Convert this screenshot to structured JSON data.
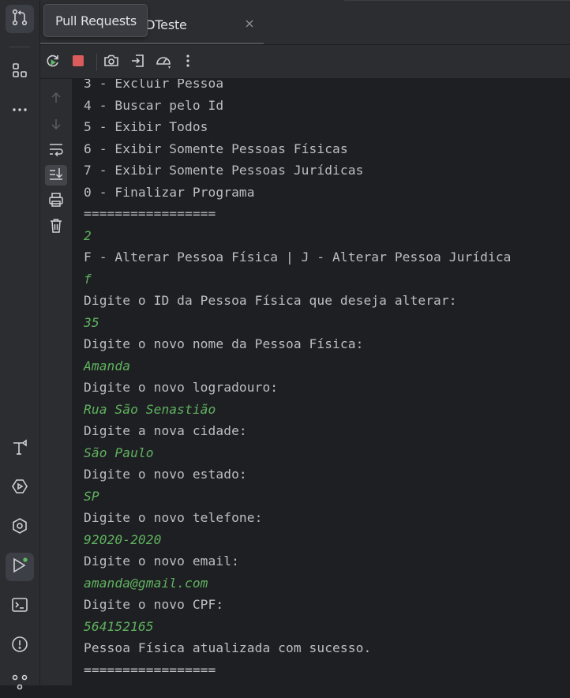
{
  "tooltip": {
    "text": "Pull Requests"
  },
  "tab": {
    "title": "astroBDTeste"
  },
  "console": {
    "lines": [
      {
        "text": "3 - Excluir Pessoa",
        "input": false
      },
      {
        "text": "4 - Buscar pelo Id",
        "input": false
      },
      {
        "text": "5 - Exibir Todos",
        "input": false
      },
      {
        "text": "6 - Exibir Somente Pessoas Físicas",
        "input": false
      },
      {
        "text": "7 - Exibir Somente Pessoas Jurídicas",
        "input": false
      },
      {
        "text": "0 - Finalizar Programa",
        "input": false
      },
      {
        "text": "=================",
        "input": false
      },
      {
        "text": "2",
        "input": true
      },
      {
        "text": "F - Alterar Pessoa Física | J - Alterar Pessoa Jurídica",
        "input": false
      },
      {
        "text": "f",
        "input": true
      },
      {
        "text": "Digite o ID da Pessoa Física que deseja alterar:",
        "input": false
      },
      {
        "text": "35",
        "input": true
      },
      {
        "text": "Digite o novo nome da Pessoa Física:",
        "input": false
      },
      {
        "text": "Amanda",
        "input": true
      },
      {
        "text": "Digite o novo logradouro:",
        "input": false
      },
      {
        "text": "Rua São Senastião",
        "input": true
      },
      {
        "text": "Digite a nova cidade:",
        "input": false
      },
      {
        "text": "São Paulo",
        "input": true
      },
      {
        "text": "Digite o novo estado:",
        "input": false
      },
      {
        "text": "SP",
        "input": true
      },
      {
        "text": "Digite o novo telefone:",
        "input": false
      },
      {
        "text": "92020-2020",
        "input": true
      },
      {
        "text": "Digite o novo email:",
        "input": false
      },
      {
        "text": "amanda@gmail.com",
        "input": true
      },
      {
        "text": "Digite o novo CPF:",
        "input": false
      },
      {
        "text": "564152165",
        "input": true
      },
      {
        "text": "Pessoa Física atualizada com sucesso.",
        "input": false
      },
      {
        "text": "=================",
        "input": false
      }
    ]
  },
  "icons": {
    "activity_bar": [
      "pull-requests-icon",
      "structure-icon",
      "more-icon",
      "build-icon",
      "services-icon",
      "plugins-icon",
      "run-icon",
      "terminal-icon",
      "problems-icon",
      "version-control-icon"
    ],
    "toolbar": [
      "rerun-icon",
      "stop-icon",
      "screenshot-icon",
      "restore-layout-icon",
      "profiler-icon",
      "more-options-icon"
    ],
    "gutter": [
      "scroll-up-icon",
      "scroll-down-icon",
      "soft-wrap-icon",
      "scroll-to-end-icon",
      "print-icon",
      "clear-all-icon"
    ]
  },
  "colors": {
    "background": "#1e1f22",
    "panel": "#2b2d30",
    "console_text": "#bcbec4",
    "user_input": "#5fb25f",
    "stop_red": "#db5c5c",
    "run_green": "#5fb865"
  }
}
